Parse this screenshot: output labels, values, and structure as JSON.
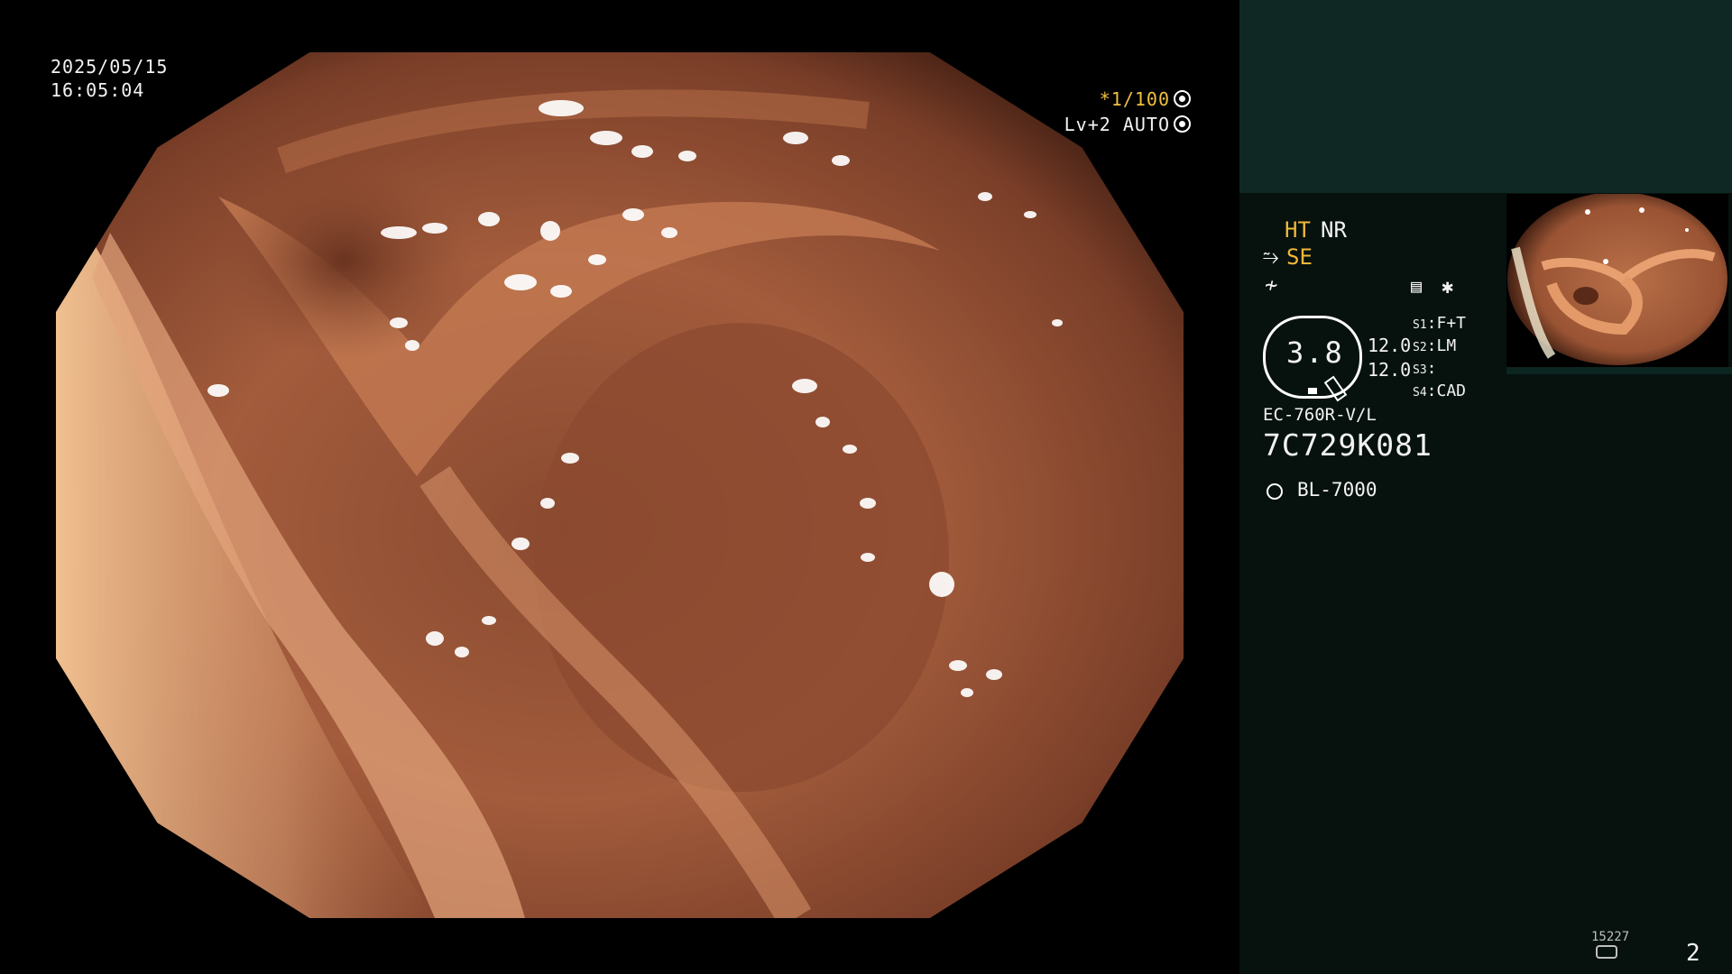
{
  "overlay": {
    "date": "2025/05/15",
    "time": "16:05:04",
    "shutter": "*1/100",
    "shutter_icon": "shutter-icon",
    "level": "Lv+2 AUTO",
    "level_icon": "auto-iris-icon"
  },
  "panel": {
    "enhancement": {
      "ht": "HT",
      "nr": "NR",
      "se": "SE"
    },
    "iris_value": "3.8",
    "values": [
      "12.0",
      "12.0"
    ],
    "switches": [
      {
        "key": "S1",
        "label": "F+T"
      },
      {
        "key": "S2",
        "label": "LM"
      },
      {
        "key": "S3",
        "label": ""
      },
      {
        "key": "S4",
        "label": "CAD"
      }
    ],
    "scope_model": "EC-760R-V/L",
    "scope_serial": "7C729K081",
    "light_source": "BL-7000",
    "disk_count": "15227",
    "page_number": "2"
  },
  "colors": {
    "panel_bg": "#07120f",
    "panel_top_bg": "#0f2823",
    "highlight_text": "#f0b838",
    "mucosa": "#a0583a"
  }
}
